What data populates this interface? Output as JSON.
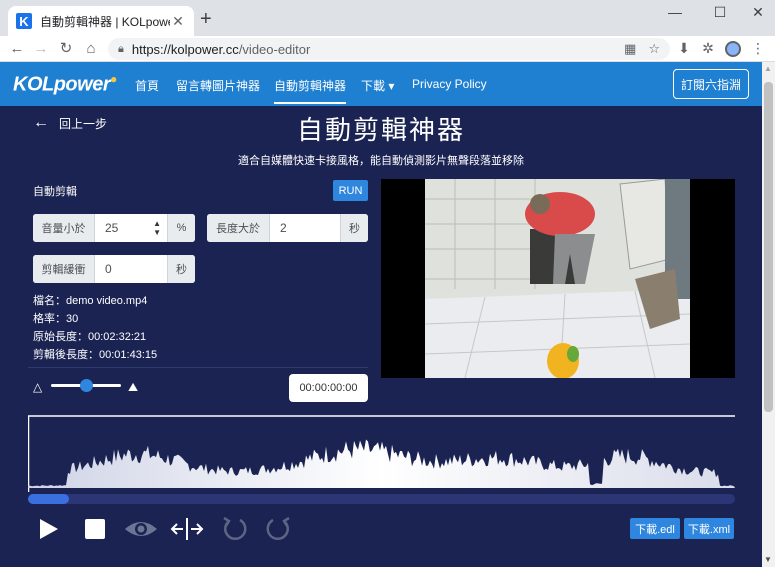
{
  "browser": {
    "tab_title": "自動剪輯神器 | KOLpower",
    "tab_favicon": "K",
    "url_host": "https://kolpower.cc",
    "url_path": "/video-editor"
  },
  "nav": {
    "logo": "KOLpower",
    "links": [
      "首頁",
      "留言轉圖片神器",
      "自動剪輯神器",
      "下載 ▾",
      "Privacy Policy"
    ],
    "subscribe": "訂閱六指淵"
  },
  "main": {
    "back": "回上一步",
    "title": "自動剪輯神器",
    "subtitle": "適合自媒體快速卡接風格，能自動偵測影片無聲段落並移除",
    "auto_label": "自動剪輯",
    "run": "RUN",
    "volume": {
      "label": "音量小於",
      "value": "25",
      "unit": "%"
    },
    "length": {
      "label": "長度大於",
      "value": "2",
      "unit": "秒"
    },
    "buffer": {
      "label": "剪輯緩衝",
      "value": "0",
      "unit": "秒"
    },
    "info": [
      "檔名：demo video.mp4",
      "格率：30",
      "原始長度：00:02:32:21",
      "剪輯後長度：00:01:43:15"
    ],
    "timecode": "00:00:00:00",
    "zoom_level": 0.5,
    "playback_progress": 0.058,
    "download_edl": "下載.edl",
    "download_xml": "下載.xml"
  },
  "colors": {
    "page_bg": "#1a2352",
    "navbar": "#1f7fd0",
    "accent": "#2f86de"
  }
}
